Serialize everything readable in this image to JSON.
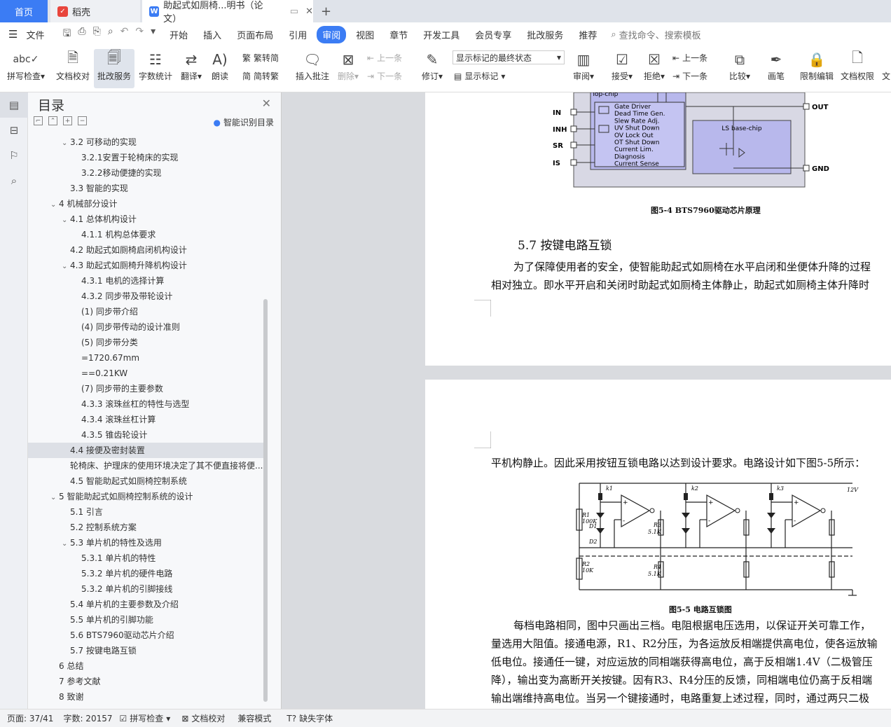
{
  "tabs": {
    "home": "首页",
    "wps": "稻壳",
    "doc": "助起式如厕椅...明书（论文）"
  },
  "menu": {
    "file": "文件",
    "items": [
      "开始",
      "插入",
      "页面布局",
      "引用",
      "审阅",
      "视图",
      "章节",
      "开发工具",
      "会员专享",
      "批改服务",
      "推荐"
    ],
    "search": "查找命令、搜索模板"
  },
  "ribbon": {
    "spell": "拼写检查",
    "doccheck": "文档校对",
    "correct": "批改服务",
    "wordcount": "字数统计",
    "translate": "翻译",
    "read": "朗读",
    "t2s": "繁转简",
    "s2t": "简转繁",
    "addcomment": "插入批注",
    "delete": "删除",
    "prev": "上一条",
    "next": "下一条",
    "revise": "修订",
    "markstate": "显示标记的最终状态",
    "showmark": "显示标记",
    "review": "审阅",
    "accept": "接受",
    "reject": "拒绝",
    "prev2": "上一条",
    "next2": "下一条",
    "compare": "比较",
    "pen": "画笔",
    "restrict": "限制编辑",
    "perm": "文档权限",
    "more": "文"
  },
  "toc": {
    "title": "目录",
    "smart": "智能识别目录",
    "items": [
      {
        "t": "3.2 可移动的实现",
        "lvl": 1,
        "car": "v"
      },
      {
        "t": "3.2.1安置于轮椅床的实现",
        "lvl": 2,
        "car": ""
      },
      {
        "t": "3.2.2移动便捷的实现",
        "lvl": 2,
        "car": ""
      },
      {
        "t": "3.3 智能的实现",
        "lvl": 1,
        "car": ""
      },
      {
        "t": "4 机械部分设计",
        "lvl": 0,
        "car": "v"
      },
      {
        "t": "4.1 总体机构设计",
        "lvl": 1,
        "car": "v"
      },
      {
        "t": "4.1.1 机构总体要求",
        "lvl": 2,
        "car": ""
      },
      {
        "t": "4.2 助起式如厕椅启闭机构设计",
        "lvl": 1,
        "car": ""
      },
      {
        "t": "4.3 助起式如厕椅升降机构设计",
        "lvl": 1,
        "car": "v"
      },
      {
        "t": "4.3.1 电机的选择计算",
        "lvl": 2,
        "car": ""
      },
      {
        "t": "4.3.2 同步带及带轮设计",
        "lvl": 2,
        "car": ""
      },
      {
        "t": "(1)  同步带介绍",
        "lvl": 2,
        "car": ""
      },
      {
        "t": "(4)   同步带传动的设计准则",
        "lvl": 2,
        "car": ""
      },
      {
        "t": "(5)   同步带分类",
        "lvl": 2,
        "car": ""
      },
      {
        "t": "=1720.67mm",
        "lvl": 2,
        "car": ""
      },
      {
        "t": "==0.21KW",
        "lvl": 2,
        "car": ""
      },
      {
        "t": "(7)  同步带的主要参数",
        "lvl": 2,
        "car": ""
      },
      {
        "t": "4.3.3 滚珠丝杠的特性与选型",
        "lvl": 2,
        "car": ""
      },
      {
        "t": "4.3.4 滚珠丝杠计算",
        "lvl": 2,
        "car": ""
      },
      {
        "t": "4.3.5 锥齿轮设计",
        "lvl": 2,
        "car": ""
      },
      {
        "t": "4.4 接便及密封装置",
        "lvl": 1,
        "car": "",
        "sel": true
      },
      {
        "t": "轮椅床、护理床的使用环境决定了其不便直接将便...",
        "lvl": 1,
        "car": ""
      },
      {
        "t": "4.5 智能助起式如厕椅控制系统",
        "lvl": 1,
        "car": ""
      },
      {
        "t": "5 智能助起式如厕椅控制系统的设计",
        "lvl": 0,
        "car": "v"
      },
      {
        "t": "5.1 引言",
        "lvl": 1,
        "car": ""
      },
      {
        "t": "5.2 控制系统方案",
        "lvl": 1,
        "car": ""
      },
      {
        "t": "5.3 单片机的特性及选用",
        "lvl": 1,
        "car": "v"
      },
      {
        "t": "5.3.1 单片机的特性",
        "lvl": 2,
        "car": ""
      },
      {
        "t": "5.3.2 单片机的硬件电路",
        "lvl": 2,
        "car": ""
      },
      {
        "t": "5.3.2 单片机的引脚接线",
        "lvl": 2,
        "car": ""
      },
      {
        "t": "5.4 单片机的主要参数及介绍",
        "lvl": 1,
        "car": ""
      },
      {
        "t": "5.5 单片机的引脚功能",
        "lvl": 1,
        "car": ""
      },
      {
        "t": "5.6 BTS7960驱动芯片介绍",
        "lvl": 1,
        "car": ""
      },
      {
        "t": "5.7 按键电路互锁",
        "lvl": 1,
        "car": ""
      },
      {
        "t": "6 总结",
        "lvl": 0,
        "car": ""
      },
      {
        "t": "7 参考文献",
        "lvl": 0,
        "car": ""
      },
      {
        "t": "8 致谢",
        "lvl": 0,
        "car": ""
      }
    ]
  },
  "doc": {
    "fig54": {
      "topchip": "Top-chip",
      "block": [
        "Gate Driver",
        "Dead Time Gen.",
        "Slew Rate Adj.",
        "UV Shut Down",
        "OV Lock Out",
        "OT Shut Down",
        "Current Lim.",
        "Diagnosis",
        "Current Sense"
      ],
      "lsbase": "LS base-chip",
      "pins": [
        "IN",
        "INH",
        "SR",
        "IS"
      ],
      "out": "OUT",
      "gnd": "GND",
      "caption": "图5-4 BTS7960驱动芯片原理"
    },
    "heading57": "5.7 按键电路互锁",
    "p1a": "为了保障使用者的安全，使智能助起式如厕椅在水平启闭和坐便体升降的过程",
    "p1b": "相对独立。即水平开启和关闭时助起式如厕椅主体静止，助起式如厕椅主体升降时",
    "p2": "平机构静止。因此采用按钮互锁电路以达到设计要求。电路设计如下图5-5所示：",
    "fig55": {
      "keys": [
        "k1",
        "k2",
        "k3"
      ],
      "v12": "12V",
      "r1": "R1",
      "r1v": "100K",
      "d1": "D1",
      "d2": "D2",
      "r3": "R3",
      "r3v": "5.1K",
      "r2": "R2",
      "r2v": "10K",
      "r4": "R4",
      "r4v": "5.1K",
      "caption": "图5-5 电路互锁图"
    },
    "p3a": "每档电路相同，图中只画出三档。电阻根据电压选用，以保证开关可靠工作，",
    "p3b": "量选用大阻值。接通电源，R1、R2分压，为各运放反相端提供高电位，使各运放输",
    "p3c": "低电位。接通任一键，对应运放的同相端获得高电位，高于反相端1.4V（二极管压",
    "p3d": "降），输出变为高断开关按键。因有R3、R4分压的反馈，同相端电位仍高于反相端",
    "p3e": "输出端维持高电位。当另一个键接通时，电路重复上述过程，同时，通过两只二极"
  },
  "status": {
    "page": "页面: 37/41",
    "words": "字数: 20157",
    "spell": "拼写检查",
    "check": "文档校对",
    "compat": "兼容模式",
    "font": "缺失字体"
  }
}
